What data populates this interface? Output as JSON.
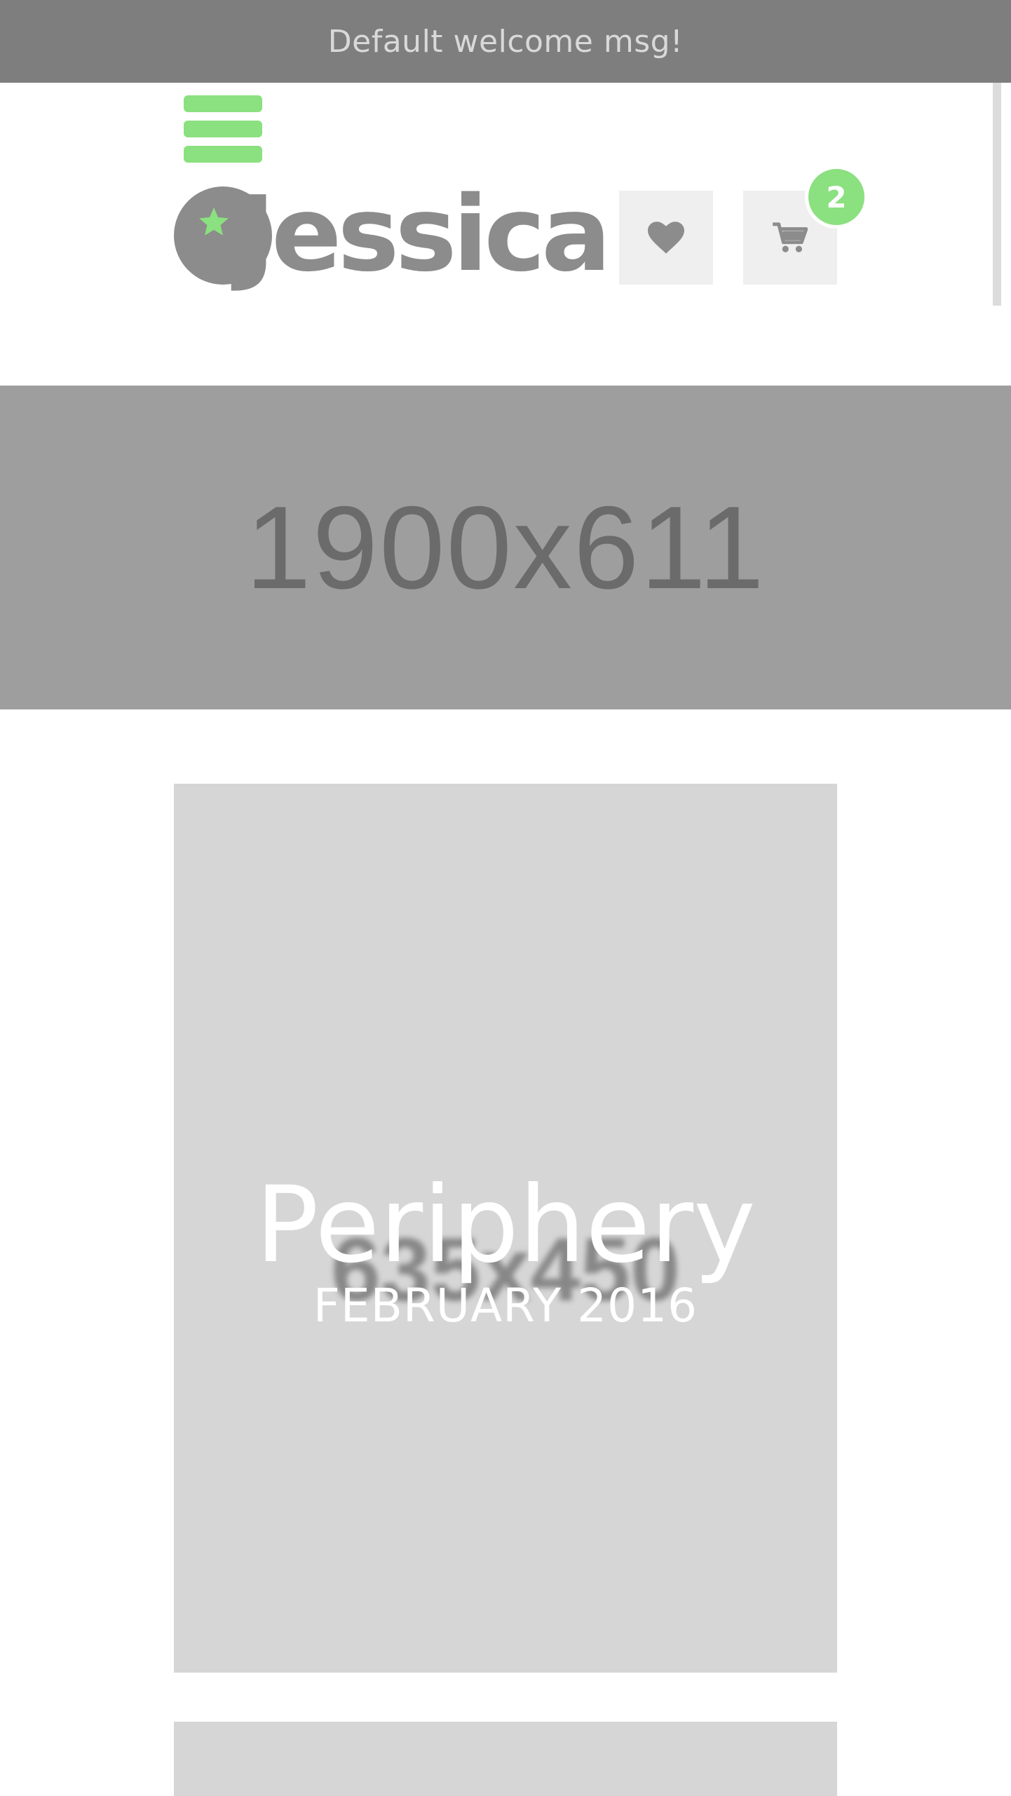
{
  "header": {
    "welcome_message": "Default welcome msg!",
    "logo_text": "Jessica",
    "cart_count": "2",
    "menu_icon": "hamburger-icon",
    "wishlist_icon": "heart-icon",
    "cart_icon": "cart-icon"
  },
  "banner": {
    "placeholder_text": "1900x611"
  },
  "featured": {
    "placeholder_text": "635x450",
    "title": "Periphery",
    "date": "FEBRUARY 2016"
  },
  "colors": {
    "accent": "#8be07f",
    "top_bar": "#7e7e7e",
    "banner_bg": "#9e9e9e",
    "card_bg": "#d6d6d6",
    "icon_gray": "#8c8c8c"
  }
}
